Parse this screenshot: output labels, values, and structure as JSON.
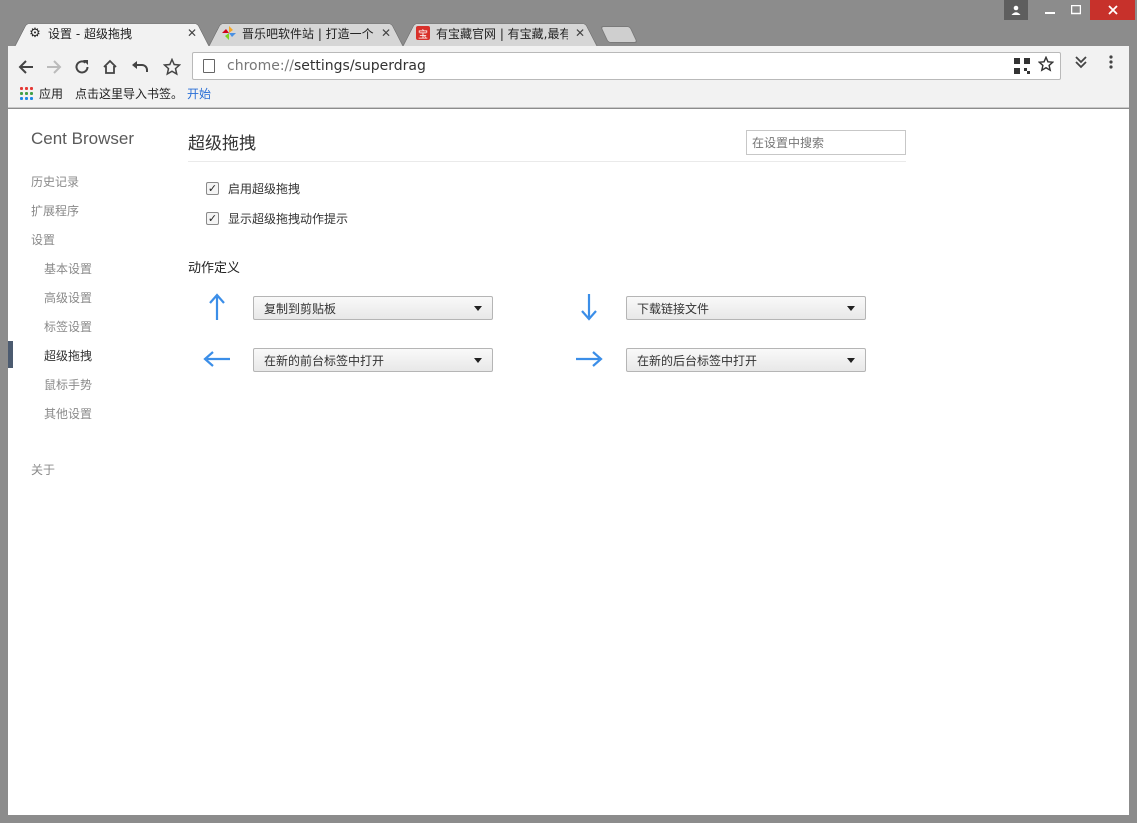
{
  "window": {
    "tabs": [
      {
        "title": "设置 - 超级拖拽",
        "icon": "gear-icon",
        "active": true
      },
      {
        "title": "晋乐吧软件站 | 打造一个",
        "icon": "pinwheel-icon",
        "active": false
      },
      {
        "title": "有宝藏官网 | 有宝藏,最有",
        "icon": "bao-icon",
        "icon_text": "宝",
        "active": false
      }
    ],
    "close_glyph": "✕"
  },
  "toolbar": {
    "url_scheme": "chrome://",
    "url_rest": "settings/superdrag"
  },
  "bookmarks": {
    "apps_label": "应用",
    "hint": "点击这里导入书签。",
    "start": "开始"
  },
  "sidebar": {
    "brand": "Cent Browser",
    "items": [
      {
        "label": "历史记录",
        "level": "top"
      },
      {
        "label": "扩展程序",
        "level": "top"
      },
      {
        "label": "设置",
        "level": "top"
      },
      {
        "label": "基本设置",
        "level": "sub"
      },
      {
        "label": "高级设置",
        "level": "sub"
      },
      {
        "label": "标签设置",
        "level": "sub"
      },
      {
        "label": "超级拖拽",
        "level": "sub",
        "selected": true
      },
      {
        "label": "鼠标手势",
        "level": "sub"
      },
      {
        "label": "其他设置",
        "level": "sub"
      },
      {
        "label": "关于",
        "level": "top"
      }
    ]
  },
  "main": {
    "title": "超级拖拽",
    "search_placeholder": "在设置中搜索",
    "checks": [
      {
        "label": "启用超级拖拽",
        "checked": true
      },
      {
        "label": "显示超级拖拽动作提示",
        "checked": true
      }
    ],
    "section_title": "动作定义",
    "actions": {
      "up": "复制到剪贴板",
      "down": "下载链接文件",
      "left": "在新的前台标签中打开",
      "right": "在新的后台标签中打开"
    },
    "arrow_color": "#3b8ee8"
  }
}
